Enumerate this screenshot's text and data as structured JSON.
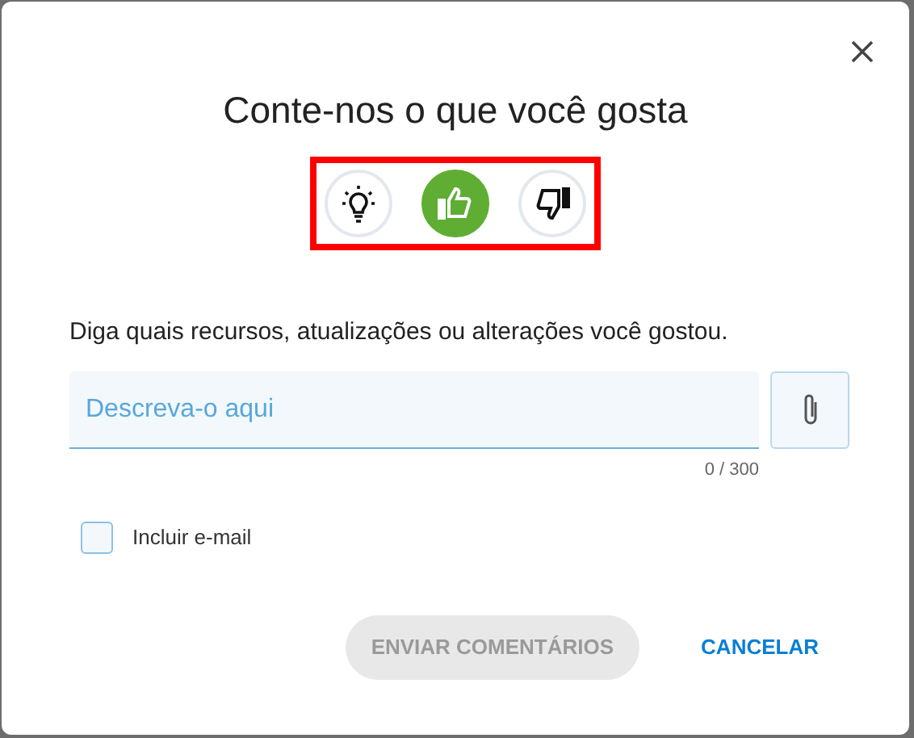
{
  "dialog": {
    "title": "Conte-nos o que você gosta"
  },
  "feedback_types": [
    {
      "kind": "idea",
      "selected": false
    },
    {
      "kind": "like",
      "selected": true
    },
    {
      "kind": "dislike",
      "selected": false
    }
  ],
  "prompt": "Diga quais recursos, atualizações ou alterações você gostou.",
  "comment_field": {
    "placeholder": "Descreva-o aqui",
    "counter": "0 / 300"
  },
  "include_email": {
    "label": "Incluir e-mail",
    "checked": false
  },
  "buttons": [
    {
      "label": "ENVIAR COMENTÁRIOS",
      "kind": "primary",
      "disabled": true
    },
    {
      "label": "CANCELAR",
      "kind": "link",
      "disabled": false
    }
  ]
}
